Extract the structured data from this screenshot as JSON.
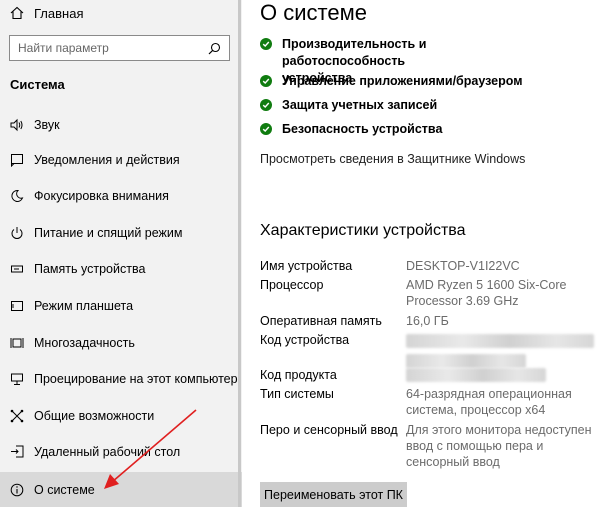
{
  "sidebar": {
    "home_label": "Главная",
    "search_placeholder": "Найти параметр",
    "section_title": "Система",
    "items": [
      {
        "label": "Звук",
        "icon": "speaker-icon"
      },
      {
        "label": "Уведомления и действия",
        "icon": "notification-icon"
      },
      {
        "label": "Фокусировка внимания",
        "icon": "moon-icon"
      },
      {
        "label": "Питание и спящий режим",
        "icon": "power-icon"
      },
      {
        "label": "Память устройства",
        "icon": "storage-icon"
      },
      {
        "label": "Режим планшета",
        "icon": "tablet-icon"
      },
      {
        "label": "Многозадачность",
        "icon": "multitask-icon"
      },
      {
        "label": "Проецирование на этот компьютер",
        "icon": "projector-icon"
      },
      {
        "label": "Общие возможности",
        "icon": "shared-icon"
      },
      {
        "label": "Удаленный рабочий стол",
        "icon": "remote-desktop-icon"
      },
      {
        "label": "О системе",
        "icon": "info-icon",
        "active": true
      }
    ]
  },
  "main": {
    "title": "О системе",
    "security": [
      "Производительность и работоспособность устройства",
      "Управление приложениями/браузером",
      "Защита учетных записей",
      "Безопасность устройства"
    ],
    "defender_link": "Просмотреть сведения в Защитнике Windows",
    "specs_title": "Характеристики устройства",
    "specs": [
      {
        "key": "Имя устройства",
        "value": "DESKTOP-V1I22VC"
      },
      {
        "key": "Процессор",
        "value": "AMD Ryzen 5 1600 Six-Core Processor 3.69 GHz"
      },
      {
        "key": "Оперативная память",
        "value": "16,0 ГБ"
      },
      {
        "key": "Код устройства",
        "value": ""
      },
      {
        "key": "Код продукта",
        "value": ""
      },
      {
        "key": "Тип системы",
        "value": "64-разрядная операционная система, процессор x64"
      },
      {
        "key": "Перо и сенсорный ввод",
        "value": "Для этого монитора недоступен ввод с помощью пера и сенсорный ввод"
      }
    ],
    "rename_button": "Переименовать этот ПК"
  },
  "colors": {
    "sidebar_bg": "#f2f2f2",
    "active_bg": "#d9d9d9",
    "check_green": "#107c10",
    "annotation_arrow": "#e02020",
    "button_bg": "#cccccc"
  }
}
